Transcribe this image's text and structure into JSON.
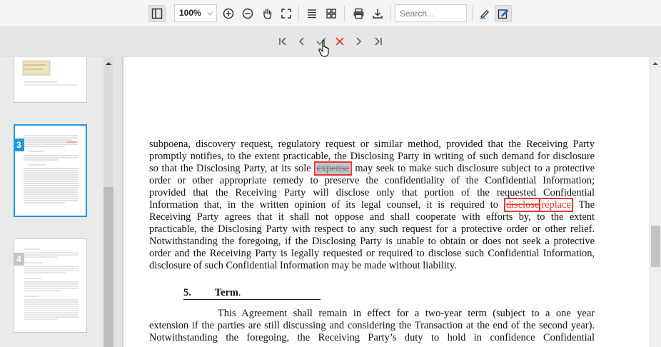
{
  "toolbar": {
    "zoom_value": "100%",
    "search_placeholder": "Search...",
    "icons": [
      "sidebar-toggle-icon",
      "zoom-in-icon",
      "zoom-out-icon",
      "pan-hand-icon",
      "fullscreen-icon",
      "text-select-icon",
      "grid-view-icon",
      "print-icon",
      "download-icon",
      "annotate-pen-icon",
      "edit-mode-icon"
    ]
  },
  "review_nav": {
    "icons": [
      "first-change-icon",
      "prev-change-icon",
      "accept-change-icon",
      "reject-change-icon",
      "next-change-icon",
      "last-change-icon"
    ],
    "accept_color": "#4caf50",
    "reject_color": "#e53935"
  },
  "sidebar": {
    "pages": [
      {
        "number": "3",
        "active": true
      },
      {
        "number": "4",
        "active": false
      }
    ],
    "active_color": "#1d9ad6"
  },
  "document": {
    "lines": [
      "subpoena, discovery request, regulatory request or similar method, provided that the Receiving Party",
      "promptly notifies, to the extent practicable, the Disclosing Party in writing of such demand for disclosure"
    ],
    "line3_pre": "so that the Disclosing Party, at its sole",
    "deleted_word_1": "expense",
    "line3_post": "may seek to make such disclosure subject to a protective",
    "lines_mid": [
      "order or other appropriate remedy to preserve the confidentiality of the Confidential Information;",
      "provided that the Receiving Party will disclose only that portion of the requested Confidential"
    ],
    "line6_pre": "Information that, in the written opinion of its legal counsel, it is required to",
    "deleted_word_2": "disclose",
    "inserted_word": "replace",
    "line6_post": "The",
    "lines_end": [
      "Receiving Party agrees that it shall not oppose and shall cooperate with efforts by, to the extent",
      "practicable, the Disclosing Party with respect to any such request for a protective order or other relief.",
      "Notwithstanding the foregoing, if the Disclosing Party is unable to obtain or does not seek a protective",
      "order and the Receiving Party is legally requested or required to disclose such Confidential Information,",
      "disclosure of such Confidential Information may be made without liability."
    ],
    "section_number": "5.",
    "section_title": "Term",
    "section_period": ".",
    "term_lines": [
      "This Agreement shall remain in effect for a two-year term (subject to a one year",
      "extension if the parties are still discussing and considering the Transaction at the end of the second year).",
      "Notwithstanding the foregoing, the Receiving Party’s duty to hold in confidence Confidential"
    ]
  }
}
